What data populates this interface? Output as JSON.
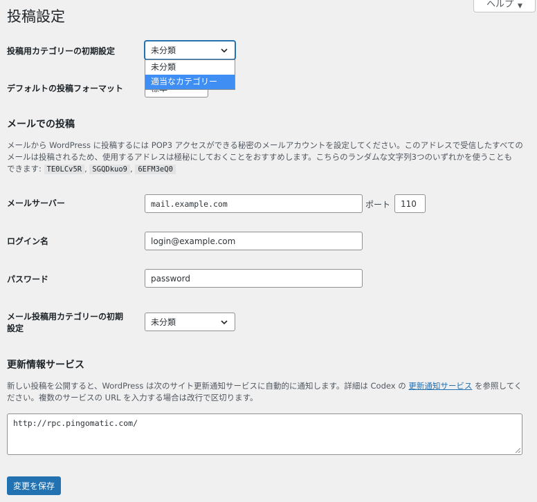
{
  "header": {
    "help_label": "ヘルプ",
    "help_arrow": "▼"
  },
  "page_title": "投稿設定",
  "default_category": {
    "label": "投稿用カテゴリーの初期設定",
    "selected": "未分類",
    "options": [
      "未分類",
      "適当なカテゴリー"
    ],
    "highlighted_option": "適当なカテゴリー"
  },
  "default_format": {
    "label": "デフォルトの投稿フォーマット",
    "selected": "標準"
  },
  "mail_section": {
    "heading": "メールでの投稿",
    "description_line1": "メールから WordPress に投稿するには POP3 アクセスができる秘密のメールアカウントを設定してください。このアドレスで受信したすべての",
    "description_line2": "メールは投稿されるため、使用するアドレスは極秘にしておくことをおすすめします。こちらのランダムな文字列3つのいずれかを使うことも",
    "description_line3": "できます:",
    "random_strings": [
      "TE0LCv5R",
      "SGQDkuo9",
      "6EFM3eQ0"
    ],
    "server_label": "メールサーバー",
    "server_value": "mail.example.com",
    "port_label": "ポート",
    "port_value": "110",
    "login_label": "ログイン名",
    "login_value": "login@example.com",
    "password_label": "パスワード",
    "password_value": "password",
    "mail_category_label_line1": "メール投稿用カテゴリーの初期",
    "mail_category_label_line2": "設定",
    "mail_category_selected": "未分類"
  },
  "update_section": {
    "heading": "更新情報サービス",
    "desc_part1": "新しい投稿を公開すると、WordPress は次のサイト更新通知サービスに自動的に通知します。詳細は Codex の ",
    "desc_link": "更新通知サービス",
    "desc_part2": " を参照してく",
    "desc_line2": "ださい。複数のサービスの URL を入力する場合は改行で区切ります。",
    "services_value": "http://rpc.pingomatic.com/"
  },
  "save_button": "変更を保存",
  "colors": {
    "accent": "#2271b1",
    "highlight": "#3e8ef3",
    "background": "#f0f0f1"
  }
}
